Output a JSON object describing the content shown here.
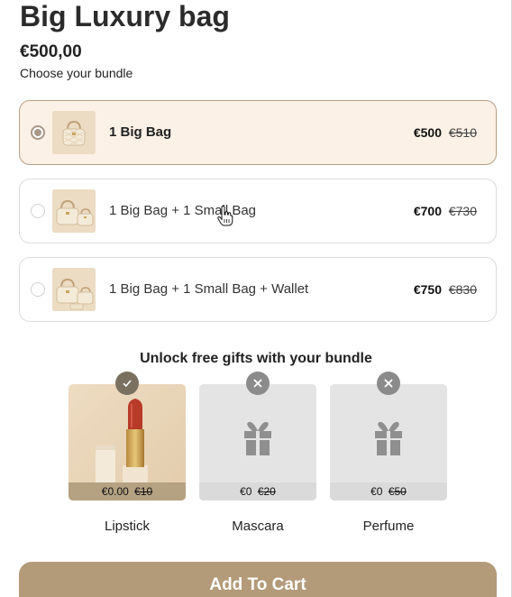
{
  "product": {
    "title": "Big Luxury bag",
    "price": "€500,00",
    "choose_label": "Choose your bundle"
  },
  "bundles": [
    {
      "label": "1 Big Bag",
      "price": "€500",
      "compare_price": "€510",
      "selected": true
    },
    {
      "label": "1 Big Bag + 1 Small Bag",
      "price": "€700",
      "compare_price": "€730",
      "selected": false
    },
    {
      "label": "1 Big Bag + 1 Small Bag + Wallet",
      "price": "€750",
      "compare_price": "€830",
      "selected": false
    }
  ],
  "gifts": {
    "heading": "Unlock free gifts with your bundle",
    "items": [
      {
        "name": "Lipstick",
        "price": "€0.00",
        "compare_price": "€10",
        "status": "unlocked",
        "icon": "check-icon"
      },
      {
        "name": "Mascara",
        "price": "€0",
        "compare_price": "€20",
        "status": "locked",
        "icon": "close-icon"
      },
      {
        "name": "Perfume",
        "price": "€0",
        "compare_price": "€50",
        "status": "locked",
        "icon": "close-icon"
      }
    ]
  },
  "cart": {
    "add_label": "Add To Cart"
  },
  "colors": {
    "accent": "#b39a78",
    "selected_bg": "#fcf1e6",
    "badge_locked": "#8b8b8b"
  }
}
